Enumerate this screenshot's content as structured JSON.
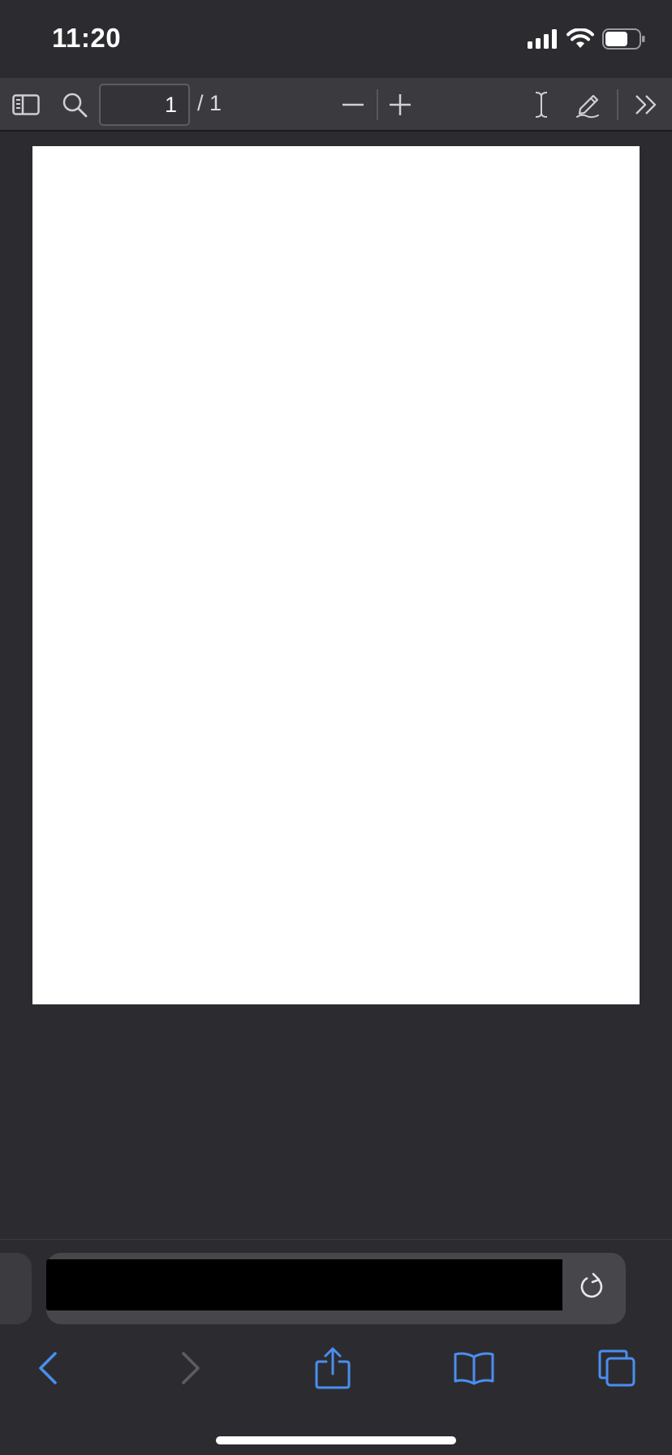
{
  "status_bar": {
    "time": "11:20"
  },
  "pdf_toolbar": {
    "current_page": "1",
    "total_pages": "/ 1",
    "icons": [
      "sidebar-icon",
      "search-icon",
      "zoom-out-icon",
      "zoom-in-icon",
      "text-cursor-icon",
      "markup-pen-icon",
      "more-chevrons-icon"
    ]
  },
  "browser": {
    "address_value": "",
    "nav_icons": [
      "back-icon",
      "forward-icon",
      "share-icon",
      "bookmarks-icon",
      "tabs-icon"
    ]
  },
  "colors": {
    "background": "#2b2b30",
    "toolbar": "#3a3a3f",
    "accent": "#4a8ef0",
    "disabled": "#5c5c62"
  }
}
